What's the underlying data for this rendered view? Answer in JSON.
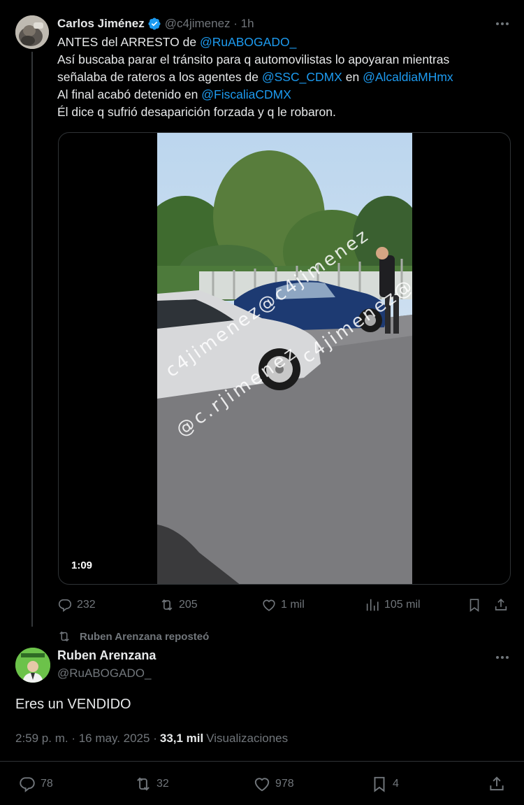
{
  "tweet": {
    "author": {
      "name": "Carlos Jiménez",
      "handle": "@c4jimenez",
      "time": "1h"
    },
    "text": {
      "line1_prefix": "ANTES del ARRESTO de ",
      "line1_mention": "@RuABOGADO_",
      "line2": "Así buscaba parar el tránsito para q automovilistas lo apoyaran mientras",
      "line3_prefix": "señalaba de rateros a los agentes de ",
      "line3_mention1": "@SSC_CDMX",
      "line3_mid": " en ",
      "line3_mention2": "@AlcaldiaMHmx",
      "line4_prefix": "Al final acabó detenido en ",
      "line4_mention": "@FiscaliaCDMX",
      "line5": "Él dice q sufrió desaparición forzada y q le robaron."
    },
    "media": {
      "duration": "1:09",
      "watermark1": "c4jimenez@c4jimenez",
      "watermark2": "c4jimenez@c4jimene",
      "watermark3": "@c.rjimenez"
    },
    "stats": {
      "replies": "232",
      "reposts": "205",
      "likes": "1 mil",
      "views": "105 mil"
    }
  },
  "repost_label": "Ruben Arenzana reposteó",
  "reply": {
    "author": {
      "name": "Ruben Arenzana",
      "handle": "@RuABOGADO_"
    },
    "text": "Eres un VENDIDO",
    "meta": {
      "time": "2:59 p. m.",
      "date": "16 may. 2025",
      "views_count": "33,1 mil",
      "views_label": "Visualizaciones"
    },
    "stats": {
      "replies": "78",
      "reposts": "32",
      "likes": "978",
      "bookmarks": "4"
    }
  },
  "colors": {
    "accent": "#1d9bf0",
    "muted": "#71767b",
    "text": "#e7e9ea",
    "background": "#000000",
    "border": "#2f3336"
  },
  "icons": [
    "verified-badge-icon",
    "more-icon",
    "reply-icon",
    "repost-icon",
    "like-icon",
    "views-icon",
    "bookmark-icon",
    "share-icon"
  ]
}
